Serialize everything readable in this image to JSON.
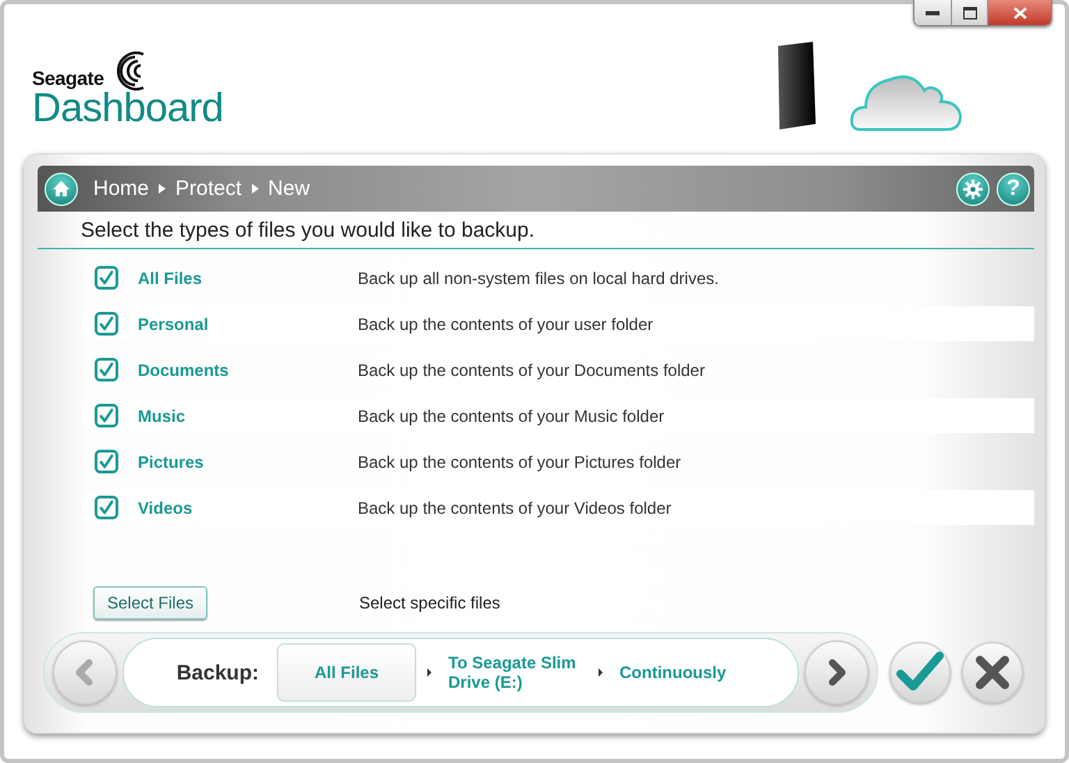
{
  "logo": {
    "brand": "Seagate",
    "product": "Dashboard"
  },
  "breadcrumb": [
    "Home",
    "Protect",
    "New"
  ],
  "help_button": "?",
  "instruction": "Select the types of files you would like to backup.",
  "file_types": [
    {
      "name": "All Files",
      "description": "Back up all non-system files on local hard drives.",
      "checked": true
    },
    {
      "name": "Personal",
      "description": "Back up the contents of your user folder",
      "checked": true
    },
    {
      "name": "Documents",
      "description": "Back up the contents of your Documents folder",
      "checked": true
    },
    {
      "name": "Music",
      "description": "Back up the contents of your Music folder",
      "checked": true
    },
    {
      "name": "Pictures",
      "description": "Back up the contents of your Pictures folder",
      "checked": true
    },
    {
      "name": "Videos",
      "description": "Back up the contents of your Videos folder",
      "checked": true
    }
  ],
  "select_files": {
    "button": "Select Files",
    "description": "Select specific files"
  },
  "backup_bar": {
    "label": "Backup:",
    "steps": [
      {
        "label": "All Files",
        "selected": true
      },
      {
        "label": "To Seagate Slim Drive (E:)",
        "selected": false
      },
      {
        "label": "Continuously",
        "selected": false
      }
    ]
  }
}
